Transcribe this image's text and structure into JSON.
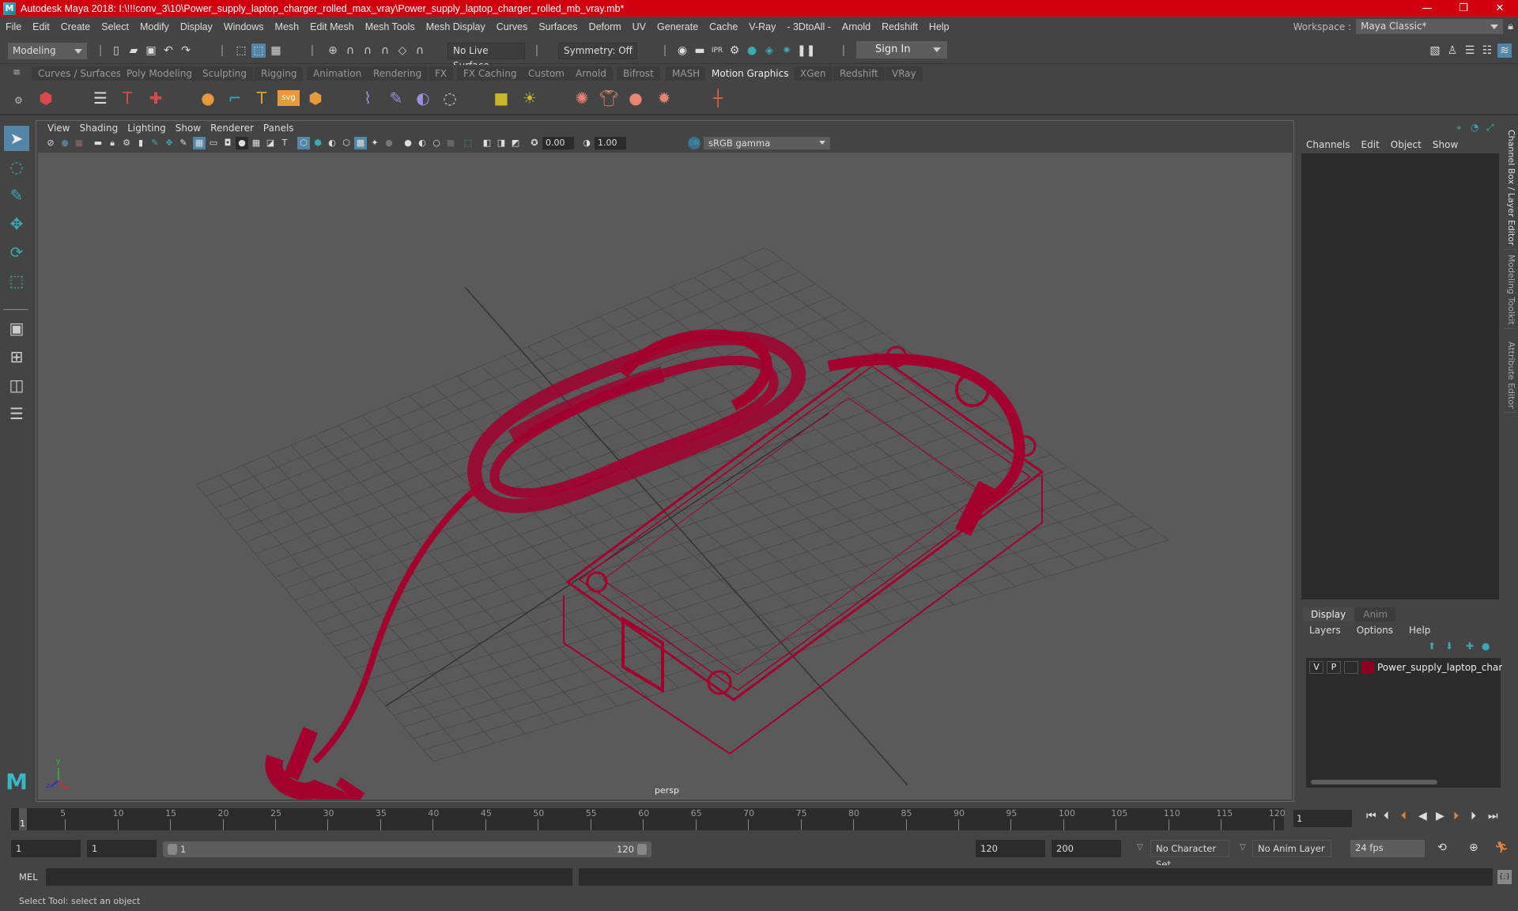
{
  "window": {
    "title": "Autodesk Maya 2018: I:\\!!!conv_3\\10\\Power_supply_laptop_charger_rolled_max_vray\\Power_supply_laptop_charger_rolled_mb_vray.mb*",
    "logo_letter": "M",
    "controls": {
      "minimize": "—",
      "maximize": "❐",
      "close": "✕"
    },
    "titlebar_color": "#d0000e"
  },
  "menubar": {
    "items": [
      "File",
      "Edit",
      "Create",
      "Select",
      "Modify",
      "Display",
      "Windows",
      "Mesh",
      "Edit Mesh",
      "Mesh Tools",
      "Mesh Display",
      "Curves",
      "Surfaces",
      "Deform",
      "UV",
      "Generate",
      "Cache",
      "V-Ray",
      "- 3DtoAll -",
      "Arnold",
      "Redshift",
      "Help"
    ],
    "workspace_label": "Workspace :",
    "workspace_value": "Maya Classic*"
  },
  "statusline": {
    "mode": "Modeling",
    "live_surface": "No Live Surface",
    "symmetry": "Symmetry: Off",
    "signin": "Sign In"
  },
  "shelf": {
    "tabs": [
      "Curves / Surfaces",
      "Poly Modeling",
      "Sculpting",
      "Rigging",
      "Animation",
      "Rendering",
      "FX",
      "FX Caching",
      "Custom",
      "Arnold",
      "Bifrost",
      "MASH",
      "Motion Graphics",
      "XGen",
      "Redshift",
      "VRay"
    ],
    "active_tab": "Motion Graphics"
  },
  "viewport": {
    "menu": [
      "View",
      "Shading",
      "Lighting",
      "Show",
      "Renderer",
      "Panels"
    ],
    "exposure": "0.00",
    "gamma": "1.00",
    "color_space": "sRGB gamma",
    "camera_label": "persp",
    "wire_color": "#a3002e",
    "axis": {
      "y": "y",
      "x": "x",
      "z": "z"
    }
  },
  "channel_box": {
    "menu": [
      "Channels",
      "Edit",
      "Object",
      "Show"
    ]
  },
  "layer_editor": {
    "tabs": [
      "Display",
      "Anim"
    ],
    "active_tab": "Display",
    "menu": [
      "Layers",
      "Options",
      "Help"
    ],
    "layers": [
      {
        "visible": "V",
        "playback": "P",
        "color": "#8c0020",
        "name": "Power_supply_laptop_charger"
      }
    ]
  },
  "side_tabs": [
    "Channel Box / Layer Editor",
    "Modeling Toolkit",
    "Attribute Editor"
  ],
  "timeline": {
    "ticks": [
      "5",
      "10",
      "15",
      "20",
      "25",
      "30",
      "35",
      "40",
      "45",
      "50",
      "55",
      "60",
      "65",
      "70",
      "75",
      "80",
      "85",
      "90",
      "95",
      "100",
      "105",
      "110",
      "115",
      "120"
    ],
    "current_frame_marker": "1",
    "current_frame": "1"
  },
  "range": {
    "start": "1",
    "anim_start": "1",
    "slider_start": "1",
    "slider_end": "120",
    "end": "120",
    "anim_end": "200",
    "character_set": "No Character Set",
    "anim_layer": "No Anim Layer",
    "fps": "24 fps"
  },
  "command_line": {
    "label": "MEL"
  },
  "help_line": {
    "text": "Select Tool: select an object"
  }
}
